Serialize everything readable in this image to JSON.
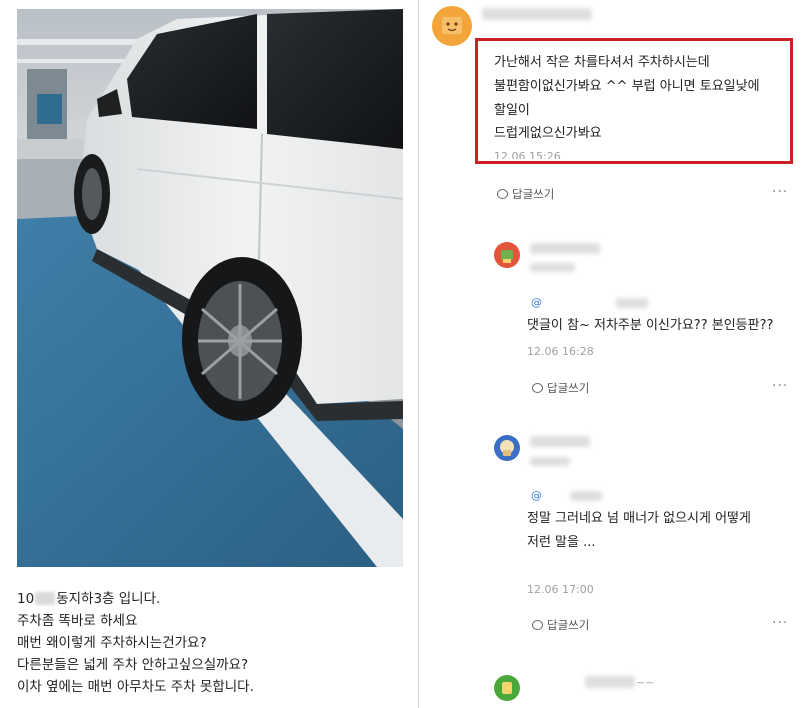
{
  "post": {
    "lines": [
      {
        "prefix": "10",
        "suffix": "동지하3층 입니다."
      },
      {
        "text": "주차좀 똑바로 하세요"
      },
      {
        "text": "매번 왜이렇게 주차하시는건가요?"
      },
      {
        "text": "다른분들은 넓게 주차 안하고싶으실까요?"
      },
      {
        "text": "이차 옆에는 매번 아무차도 주차 못합니다."
      }
    ]
  },
  "comments": [
    {
      "lines": [
        "가난해서 작은 차를타셔서 주차하시는데",
        "불편함이없신가봐요 ^^ 부럽 아니면 토요일낮에",
        "할일이",
        "드럽게없으신가봐요"
      ],
      "time": "12.06 15:26",
      "reply_label": "답글쓰기",
      "more": "···"
    },
    {
      "mention": "@",
      "lines": [
        "댓글이 참~ 저차주분 이신가요?? 본인등판??"
      ],
      "time": "12.06 16:28",
      "reply_label": "답글쓰기",
      "more": "···"
    },
    {
      "mention": "@",
      "lines": [
        "정말 그러네요 넘 매너가 없으시게 어떻게",
        "저런 말을 ..."
      ],
      "time": "12.06 17:00",
      "reply_label": "답글쓰기",
      "more": "···"
    },
    {
      "name_partial": "~~"
    }
  ],
  "colors": {
    "highlight_border": "#cc2027",
    "mention": "#3a7bd5",
    "avatar1": "#f3a43a",
    "avatar2": "#e2553a",
    "avatar3": "#3b6fc4",
    "avatar4": "#4aa83a"
  },
  "icons": [
    "reply-icon",
    "more-icon",
    "avatar-icon"
  ]
}
